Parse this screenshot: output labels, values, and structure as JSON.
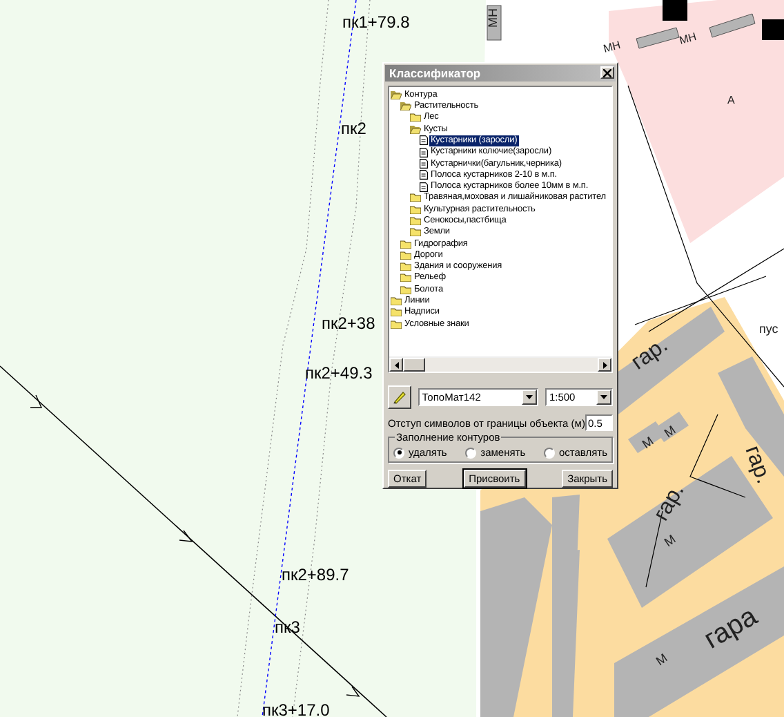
{
  "map": {
    "pickets": [
      "пк1+79.8",
      "пк2",
      "пк2+38",
      "пк2+49.3",
      "пк2+89.7",
      "пк3",
      "пк3+17.0"
    ],
    "labels": [
      "МН",
      "МН",
      "МН",
      "А",
      "пус",
      "гар.",
      "гар.",
      "гар.",
      "гара",
      "М",
      "М",
      "М",
      "М"
    ]
  },
  "dialog": {
    "title": "Классификатор",
    "tree": [
      {
        "label": "Контура",
        "kind": "folder",
        "expanded": true,
        "selected": false,
        "children": [
          {
            "label": "Растительность",
            "kind": "folder",
            "expanded": true,
            "selected": false,
            "children": [
              {
                "label": "Лес",
                "kind": "folder",
                "expanded": false,
                "selected": false
              },
              {
                "label": "Кусты",
                "kind": "folder",
                "expanded": true,
                "selected": false,
                "children": [
                  {
                    "label": "Кустарники (заросли)",
                    "kind": "doc",
                    "selected": true
                  },
                  {
                    "label": "Кустарники колючие(заросли)",
                    "kind": "doc",
                    "selected": false
                  },
                  {
                    "label": "Кустарнички(багульник,черника)",
                    "kind": "doc",
                    "selected": false
                  },
                  {
                    "label": "Полоса кустарников 2-10 в м.п.",
                    "kind": "doc",
                    "selected": false
                  },
                  {
                    "label": "Полоса кустарников более 10мм в м.п.",
                    "kind": "doc",
                    "selected": false
                  }
                ]
              },
              {
                "label": "Травяная,моховая и лишайниковая растител",
                "kind": "folder",
                "expanded": false,
                "selected": false
              },
              {
                "label": "Культурная растительность",
                "kind": "folder",
                "expanded": false,
                "selected": false
              },
              {
                "label": "Сенокосы,пастбища",
                "kind": "folder",
                "expanded": false,
                "selected": false
              },
              {
                "label": "Земли",
                "kind": "folder",
                "expanded": false,
                "selected": false
              }
            ]
          },
          {
            "label": "Гидрография",
            "kind": "folder",
            "expanded": false,
            "selected": false
          },
          {
            "label": "Дороги",
            "kind": "folder",
            "expanded": false,
            "selected": false
          },
          {
            "label": "Здания и сооружения",
            "kind": "folder",
            "expanded": false,
            "selected": false
          },
          {
            "label": "Рельеф",
            "kind": "folder",
            "expanded": false,
            "selected": false
          },
          {
            "label": "Болота",
            "kind": "folder",
            "expanded": false,
            "selected": false
          }
        ]
      },
      {
        "label": "Линии",
        "kind": "folder",
        "expanded": false,
        "selected": false
      },
      {
        "label": "Надписи",
        "kind": "folder",
        "expanded": false,
        "selected": false
      },
      {
        "label": "Условные знаки",
        "kind": "folder",
        "expanded": false,
        "selected": false
      }
    ],
    "library": "ТопоМат142",
    "scale": "1:500",
    "offset_label": "Отступ символов от границы объекта (м)",
    "offset_value": "0.5",
    "fill_group": {
      "title": "Заполнение контуров",
      "options": [
        {
          "label": "удалять",
          "selected": true
        },
        {
          "label": "заменять",
          "selected": false
        },
        {
          "label": "оставлять",
          "selected": false
        }
      ]
    },
    "buttons": [
      "Откат",
      "Присвоить",
      "Закрыть"
    ]
  }
}
